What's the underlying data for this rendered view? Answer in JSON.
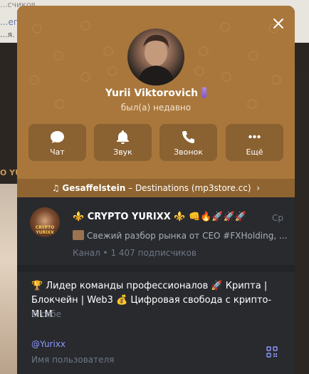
{
  "background": {
    "top_line": "...счиков",
    "chat_name": "...епл",
    "chat_text": "...я. Б",
    "label": "O YU"
  },
  "profile": {
    "name": "Yurii Viktorovich",
    "status": "был(а) недавно"
  },
  "actions": [
    {
      "label": "Чат",
      "icon": "chat-bubble-icon"
    },
    {
      "label": "Звук",
      "icon": "bell-icon"
    },
    {
      "label": "Звонок",
      "icon": "phone-icon"
    },
    {
      "label": "Ещё",
      "icon": "more-dots-icon"
    }
  ],
  "music": {
    "note": "♫",
    "artist": "Gesaffelstein",
    "separator": " – ",
    "track": "Destinations (mp3store.cc)",
    "arrow": "›"
  },
  "channel": {
    "title": "⚜️ CRYPTO YURIXX ⚜️ 👊🔥🚀🚀🚀",
    "date": "Ср",
    "preview": "Свежий разбор рынка от CEO #FXHolding, ...",
    "meta": "Канал • 1 407 подписчиков",
    "avatar_text": "CRYPTO YURIXX"
  },
  "bio": {
    "text": "🏆 Лидер команды профессионалов 🚀 Крипта | Блокчейн | Web3 💰 Цифровая свобода с крипто-MLM",
    "label": "О себе"
  },
  "username": {
    "value": "@Yurixx",
    "label": "Имя пользователя"
  },
  "colors": {
    "header": "#a9773c",
    "music_bar": "#8f6430",
    "panel": "#282a2e",
    "link": "#8e97ff",
    "muted": "#6f7785"
  }
}
